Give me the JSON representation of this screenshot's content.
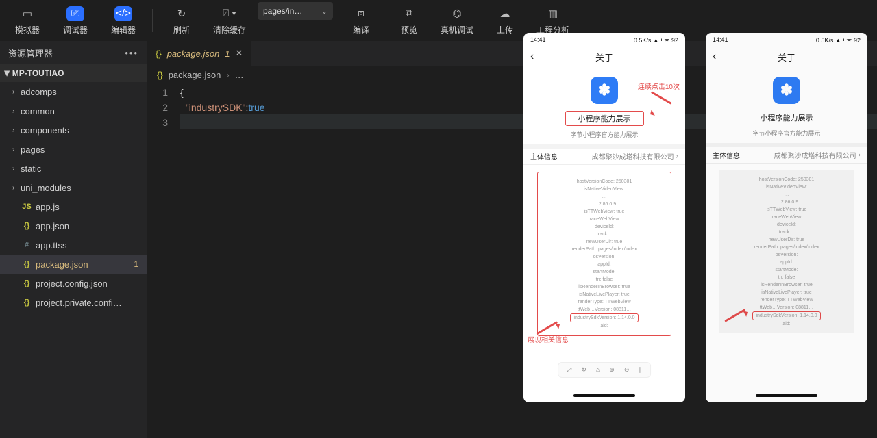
{
  "toolbar": {
    "simulator": "模拟器",
    "debugger": "调试器",
    "editor": "编辑器",
    "refresh": "刷新",
    "clear_cache": "清除缓存",
    "page_selector": "pages/in…",
    "compile": "编译",
    "preview": "预览",
    "real_device": "真机调试",
    "upload": "上传",
    "analysis": "工程分析"
  },
  "sidebar": {
    "header": "资源管理器",
    "project": "MP-TOUTIAO",
    "folders": [
      "adcomps",
      "common",
      "components",
      "pages",
      "static",
      "uni_modules"
    ],
    "files": [
      {
        "icon": "JS",
        "cls": "js",
        "name": "app.js"
      },
      {
        "icon": "{}",
        "cls": "json",
        "name": "app.json"
      },
      {
        "icon": "#",
        "cls": "hash",
        "name": "app.ttss"
      },
      {
        "icon": "{}",
        "cls": "json",
        "name": "package.json",
        "badge": "1",
        "mod": true
      },
      {
        "icon": "{}",
        "cls": "json",
        "name": "project.config.json"
      },
      {
        "icon": "{}",
        "cls": "json",
        "name": "project.private.confi…"
      }
    ]
  },
  "editor_tab": {
    "icon": "{}",
    "name": "package.json",
    "marker": "1"
  },
  "breadcrumb": {
    "icon": "{}",
    "file": "package.json",
    "rest": "…"
  },
  "code": {
    "key": "\"industrySDK\"",
    "val": "true"
  },
  "phone": {
    "time": "14:41",
    "right_status": "0.5K/s ▲ ⁞ ᯤ 92",
    "nav": "关于",
    "app_title": "小程序能力展示",
    "subtitle": "字节小程序官方能力展示",
    "info_label": "主体信息",
    "info_value": "成都聚沙成塔科技有限公司",
    "annot_top": "连续点击10次",
    "annot_bottom": "展现相关信息",
    "sdk_line": "industrySdkVersion: 1.14.0.0",
    "debug": [
      "hostVersionCode: 250301",
      "isNativeVideoView:",
      "…",
      "… 2.86.0.9",
      "isTTWebView: true",
      "traceWebView:",
      "deviceId:",
      "track…",
      "newUserDir: true",
      "renderPath: pages/index/index",
      "osVersion:",
      "appId:",
      "startMode:",
      "tn: false",
      "isRenderInBrowser: true",
      "isNativeLivePlayer: true",
      "renderType: TTWebView",
      "ttWeb…Version: 08811…"
    ]
  }
}
